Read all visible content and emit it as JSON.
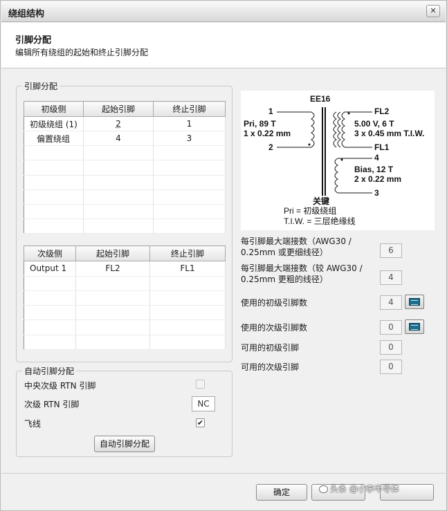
{
  "window": {
    "title": "绕组结构",
    "close_glyph": "✕"
  },
  "header": {
    "title": "引脚分配",
    "subtitle": "编辑所有绕组的起始和终止引脚分配"
  },
  "pin_group": {
    "label": "引脚分配",
    "primary_table": {
      "headers": [
        "初级侧",
        "起始引脚",
        "终止引脚"
      ],
      "rows": [
        [
          "初级绕组 (1)",
          "2",
          "1"
        ],
        [
          "偏置绕组",
          "4",
          "3"
        ]
      ]
    },
    "secondary_table": {
      "headers": [
        "次级侧",
        "起始引脚",
        "终止引脚"
      ],
      "rows": [
        [
          "Output 1",
          "FL2",
          "FL1"
        ]
      ]
    }
  },
  "diagram": {
    "core": "EE16",
    "pin1": "1",
    "pin2": "2",
    "pin4": "4",
    "pin3": "3",
    "pinFL2": "FL2",
    "pinFL1": "FL1",
    "pri_line1": "Pri,  89 T",
    "pri_line2": "1 x  0.22 mm",
    "sec_line1": "5.00 V,  6 T",
    "sec_line2": "3 x  0.45 mm T.I.W.",
    "bias_line1": "Bias, 12 T",
    "bias_line2": "2 x  0.22 mm",
    "key_title": "关键",
    "key_line1": "Pri = 初级绕组",
    "key_line2": "T.I.W. = 三层绝缘线"
  },
  "stats": [
    {
      "label1": "每引脚最大端接数（AWG30 /",
      "label2": "0.25mm 或更细线径）",
      "value": "6"
    },
    {
      "label1": "每引脚最大端接数（较 AWG30 /",
      "label2": "0.25mm 更粗的线径）",
      "value": "4"
    },
    {
      "label": "使用的初级引脚数",
      "value": "4"
    },
    {
      "label": "使用的次级引脚数",
      "value": "0"
    },
    {
      "label": "可用的初级引脚",
      "value": "0"
    },
    {
      "label": "可用的次级引脚",
      "value": "0"
    }
  ],
  "auto_group": {
    "label": "自动引脚分配",
    "center_rtn_label": "中央次级 RTN 引脚",
    "center_rtn_checked": false,
    "sec_rtn_label": "次级 RTN 引脚",
    "sec_rtn_value": "NC",
    "flying_lead_label": "飞线",
    "flying_lead_checked": true,
    "flying_lead_mark": "✔",
    "auto_button": "自动引脚分配"
  },
  "footer": {
    "ok_button": "确定",
    "watermark": "头条 @小李半导体"
  }
}
